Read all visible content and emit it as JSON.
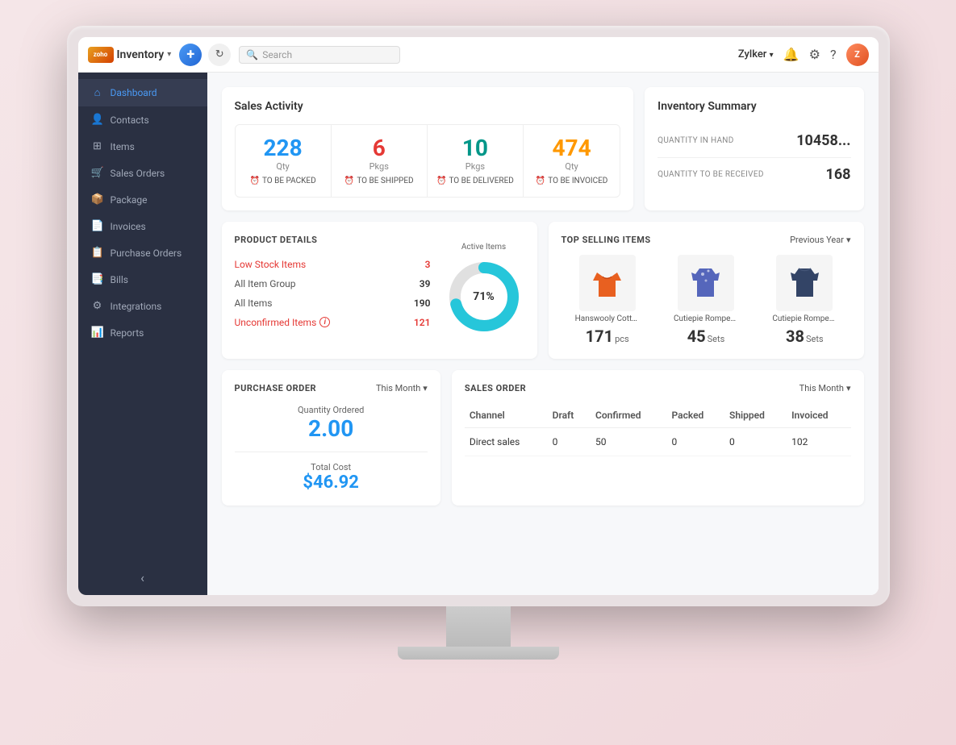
{
  "topbar": {
    "logo_text": "zoho",
    "app_name": "Inventory",
    "org_name": "Zylker",
    "search_placeholder": "Search",
    "chevron": "▾"
  },
  "sidebar": {
    "items": [
      {
        "id": "dashboard",
        "label": "Dashboard",
        "icon": "⌂",
        "active": true
      },
      {
        "id": "contacts",
        "label": "Contacts",
        "icon": "👤"
      },
      {
        "id": "items",
        "label": "Items",
        "icon": "⊞"
      },
      {
        "id": "sales-orders",
        "label": "Sales Orders",
        "icon": "🛒"
      },
      {
        "id": "package",
        "label": "Package",
        "icon": "📦"
      },
      {
        "id": "invoices",
        "label": "Invoices",
        "icon": "📄"
      },
      {
        "id": "purchase-orders",
        "label": "Purchase Orders",
        "icon": "📋"
      },
      {
        "id": "bills",
        "label": "Bills",
        "icon": "📑"
      },
      {
        "id": "integrations",
        "label": "Integrations",
        "icon": "⚙"
      },
      {
        "id": "reports",
        "label": "Reports",
        "icon": "📊"
      }
    ]
  },
  "sales_activity": {
    "title": "Sales Activity",
    "items": [
      {
        "number": "228",
        "unit": "Qty",
        "label": "TO BE PACKED",
        "color": "blue"
      },
      {
        "number": "6",
        "unit": "Pkgs",
        "label": "TO BE SHIPPED",
        "color": "red"
      },
      {
        "number": "10",
        "unit": "Pkgs",
        "label": "TO BE DELIVERED",
        "color": "teal"
      },
      {
        "number": "474",
        "unit": "Qty",
        "label": "TO BE INVOICED",
        "color": "orange"
      }
    ]
  },
  "inventory_summary": {
    "title": "Inventory Summary",
    "stats": [
      {
        "label": "QUANTITY IN HAND",
        "value": "10458..."
      },
      {
        "label": "QUANTITY TO BE RECEIVED",
        "value": "168"
      }
    ]
  },
  "product_details": {
    "title": "PRODUCT DETAILS",
    "rows": [
      {
        "label": "Low Stock Items",
        "value": "3",
        "is_link": true,
        "value_red": true
      },
      {
        "label": "All Item Group",
        "value": "39",
        "is_link": false
      },
      {
        "label": "All Items",
        "value": "190",
        "is_link": false
      },
      {
        "label": "Unconfirmed Items",
        "value": "121",
        "is_link": true,
        "has_info": true
      }
    ],
    "chart": {
      "label": "Active Items",
      "percentage": 71,
      "color_active": "#26C6DA",
      "color_inactive": "#e0e0e0"
    }
  },
  "top_selling": {
    "title": "TOP SELLING ITEMS",
    "filter": "Previous Year",
    "items": [
      {
        "name": "Hanswooly Cotton Cas...",
        "qty": "171",
        "unit": "pcs"
      },
      {
        "name": "Cutiepie Rompers-spo...",
        "qty": "45",
        "unit": "Sets"
      },
      {
        "name": "Cutiepie Rompers-jet b...",
        "qty": "38",
        "unit": "Sets"
      }
    ]
  },
  "purchase_order": {
    "title": "PURCHASE ORDER",
    "filter": "This Month",
    "qty_label": "Quantity Ordered",
    "qty_value": "2.00",
    "total_label": "Total Cost",
    "total_value": "$46.92"
  },
  "sales_order": {
    "title": "SALES ORDER",
    "filter": "This Month",
    "columns": [
      "Channel",
      "Draft",
      "Confirmed",
      "Packed",
      "Shipped",
      "Invoiced"
    ],
    "rows": [
      {
        "channel": "Direct sales",
        "draft": "0",
        "confirmed": "50",
        "packed": "0",
        "shipped": "0",
        "invoiced": "102"
      }
    ]
  }
}
